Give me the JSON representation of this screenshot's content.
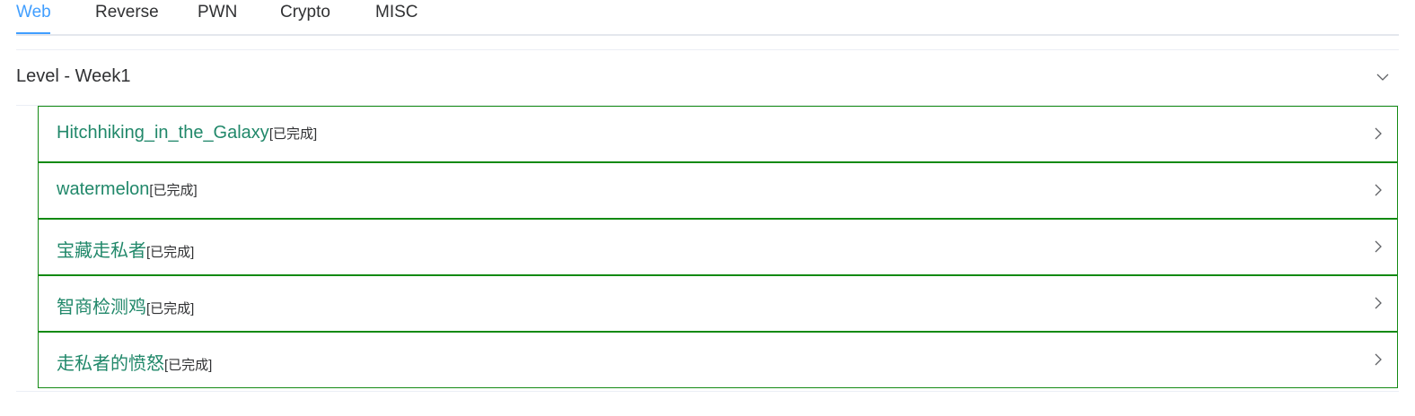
{
  "tabs": [
    {
      "label": "Web",
      "active": true
    },
    {
      "label": "Reverse",
      "active": false
    },
    {
      "label": "PWN",
      "active": false
    },
    {
      "label": "Crypto",
      "active": false
    },
    {
      "label": "MISC",
      "active": false
    }
  ],
  "section": {
    "title": "Level - Week1",
    "toggle_icon": "chevron-down-icon"
  },
  "challenges": [
    {
      "name": "Hitchhiking_in_the_Galaxy",
      "status": "[已完成]"
    },
    {
      "name": "watermelon",
      "status": "[已完成]"
    },
    {
      "name": "宝藏走私者",
      "status": "[已完成]"
    },
    {
      "name": "智商检测鸡",
      "status": "[已完成]"
    },
    {
      "name": "走私者的愤怒",
      "status": "[已完成]"
    }
  ],
  "colors": {
    "active_tab": "#409eff",
    "item_border": "#138a13",
    "item_name": "#21886a"
  }
}
